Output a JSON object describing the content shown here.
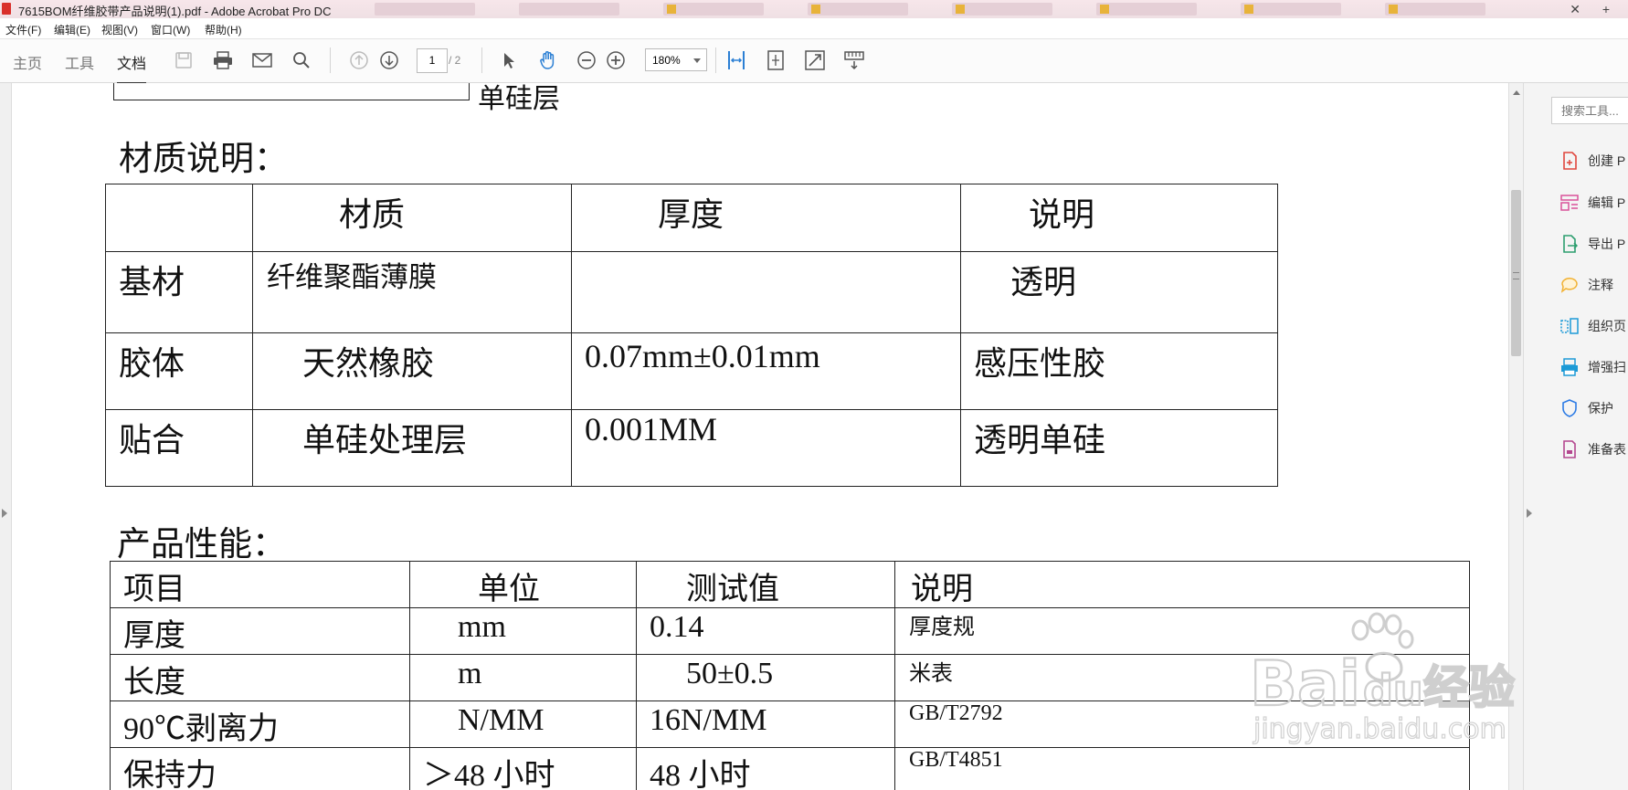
{
  "window": {
    "title": "7615BOM纤维胶带产品说明(1).pdf - Adobe Acrobat Pro DC"
  },
  "menu": [
    {
      "label": "文件(F)"
    },
    {
      "label": "编辑(E)"
    },
    {
      "label": "视图(V)"
    },
    {
      "label": "窗口(W)"
    },
    {
      "label": "帮助(H)"
    }
  ],
  "toolbar": {
    "tabs": [
      {
        "label": "主页",
        "active": false
      },
      {
        "label": "工具",
        "active": false
      },
      {
        "label": "文档",
        "active": true
      }
    ],
    "page_current": "1",
    "page_total": "/ 2",
    "zoom": "180%"
  },
  "document": {
    "top_fragment": "单硅层",
    "material_heading": "材质说明：",
    "material_table": {
      "headers": [
        "",
        "材质",
        "厚度",
        "说明"
      ],
      "rows": [
        [
          "基材",
          "纤维聚酯薄膜",
          "",
          "透明"
        ],
        [
          "胶体",
          "天然橡胶",
          "0.07mm±0.01mm",
          "感压性胶"
        ],
        [
          "贴合",
          "单硅处理层",
          "0.001MM",
          "透明单硅"
        ]
      ]
    },
    "performance_heading": "产品性能：",
    "performance_table": {
      "headers": [
        "项目",
        "单位",
        "测试值",
        "说明"
      ],
      "rows": [
        [
          "厚度",
          "mm",
          "0.14",
          "厚度规"
        ],
        [
          "长度",
          "m",
          "50±0.5",
          "米表"
        ],
        [
          "90℃剥离力",
          "N/MM",
          "16N/MM",
          "GB/T2792"
        ],
        [
          "保持力",
          "＞48 小时",
          "48 小时",
          "GB/T4851"
        ]
      ]
    }
  },
  "right_pane": {
    "search_placeholder": "搜索工具...",
    "tools": [
      {
        "label": "创建 P",
        "icon": "create-pdf-icon",
        "color": "#e0463d"
      },
      {
        "label": "编辑 P",
        "icon": "edit-pdf-icon",
        "color": "#d9519a"
      },
      {
        "label": "导出 P",
        "icon": "export-pdf-icon",
        "color": "#2d9e6f"
      },
      {
        "label": "注释",
        "icon": "comment-icon",
        "color": "#f2b233"
      },
      {
        "label": "组织页",
        "icon": "organize-pages-icon",
        "color": "#1c9ad6"
      },
      {
        "label": "增强扫",
        "icon": "enhance-scan-icon",
        "color": "#1c9ad6"
      },
      {
        "label": "保护",
        "icon": "protect-icon",
        "color": "#2c7be5"
      },
      {
        "label": "准备表",
        "icon": "prepare-form-icon",
        "color": "#b4478f"
      }
    ]
  },
  "watermark": {
    "brand_text": "Bai",
    "brand_text2": "du",
    "brand_cn": "经验",
    "url": "jingyan.baidu.com"
  }
}
